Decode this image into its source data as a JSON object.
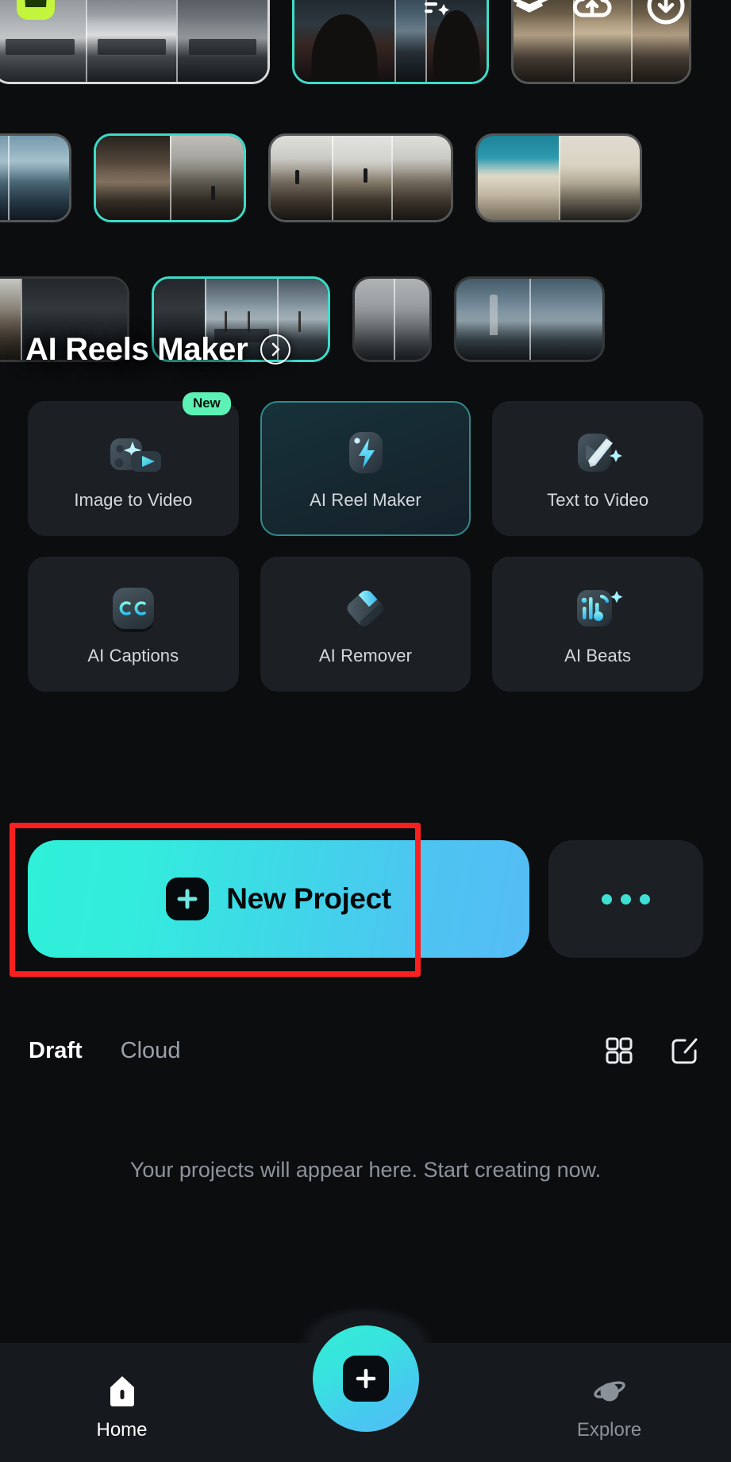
{
  "app": {
    "background": "#0b0d0f",
    "accent": "#3fe0d4",
    "accent_secondary": "#55bdf5",
    "highlight_box_color": "#fa2020",
    "new_badge_color": "#5cf2b6",
    "crown_badge_color": "#c3f53c"
  },
  "carousel": {
    "rows": [
      {
        "cards": [
          {
            "id": "reel-ferry",
            "selected": false,
            "badge": "crown-icon"
          },
          {
            "id": "reel-person",
            "selected": true,
            "badge": "none"
          },
          {
            "id": "reel-market",
            "selected": false,
            "badge": "none"
          }
        ]
      },
      {
        "cards": [
          {
            "id": "reel-sea",
            "selected": false,
            "badge": "none"
          },
          {
            "id": "reel-beach",
            "selected": true,
            "badge": "none"
          },
          {
            "id": "reel-wall",
            "selected": false,
            "badge": "none"
          },
          {
            "id": "reel-white",
            "selected": false,
            "badge": "none"
          }
        ]
      },
      {
        "cards": [
          {
            "id": "reel-hills",
            "selected": false,
            "badge": "none"
          },
          {
            "id": "reel-dock",
            "selected": true,
            "badge": "none"
          },
          {
            "id": "reel-gray",
            "selected": false,
            "badge": "none"
          },
          {
            "id": "reel-bridge",
            "selected": false,
            "badge": "none"
          }
        ]
      }
    ]
  },
  "section": {
    "title": "AI Reels Maker",
    "chevron_icon": "chevron-right-circle-icon"
  },
  "tools": [
    {
      "label": "Image to Video",
      "icon": "image-to-video-icon",
      "badge": "New",
      "active": false
    },
    {
      "label": "AI Reel Maker",
      "icon": "lightning-bolt-icon",
      "badge": "",
      "active": true
    },
    {
      "label": "Text to Video",
      "icon": "pencil-play-icon",
      "badge": "",
      "active": false
    },
    {
      "label": "AI Captions",
      "icon": "closed-captions-icon",
      "badge": "",
      "active": false
    },
    {
      "label": "AI Remover",
      "icon": "eraser-icon",
      "badge": "",
      "active": false
    },
    {
      "label": "AI Beats",
      "icon": "music-beats-icon",
      "badge": "",
      "active": false
    }
  ],
  "new_project": {
    "label": "New Project",
    "plus_icon": "plus-icon",
    "more_icon": "more-horizontal-icon"
  },
  "project_tabs": {
    "items": [
      {
        "label": "Draft",
        "active": true
      },
      {
        "label": "Cloud",
        "active": false
      }
    ],
    "grid_icon": "grid-view-icon",
    "edit_icon": "edit-square-icon"
  },
  "empty_state": {
    "message": "Your projects will appear here. Start creating now."
  },
  "bottom_nav": {
    "items": [
      {
        "label": "Home",
        "icon": "home-icon",
        "active": true
      },
      {
        "label": "Explore",
        "icon": "planet-icon",
        "active": false
      }
    ],
    "fab_icon": "plus-icon"
  }
}
